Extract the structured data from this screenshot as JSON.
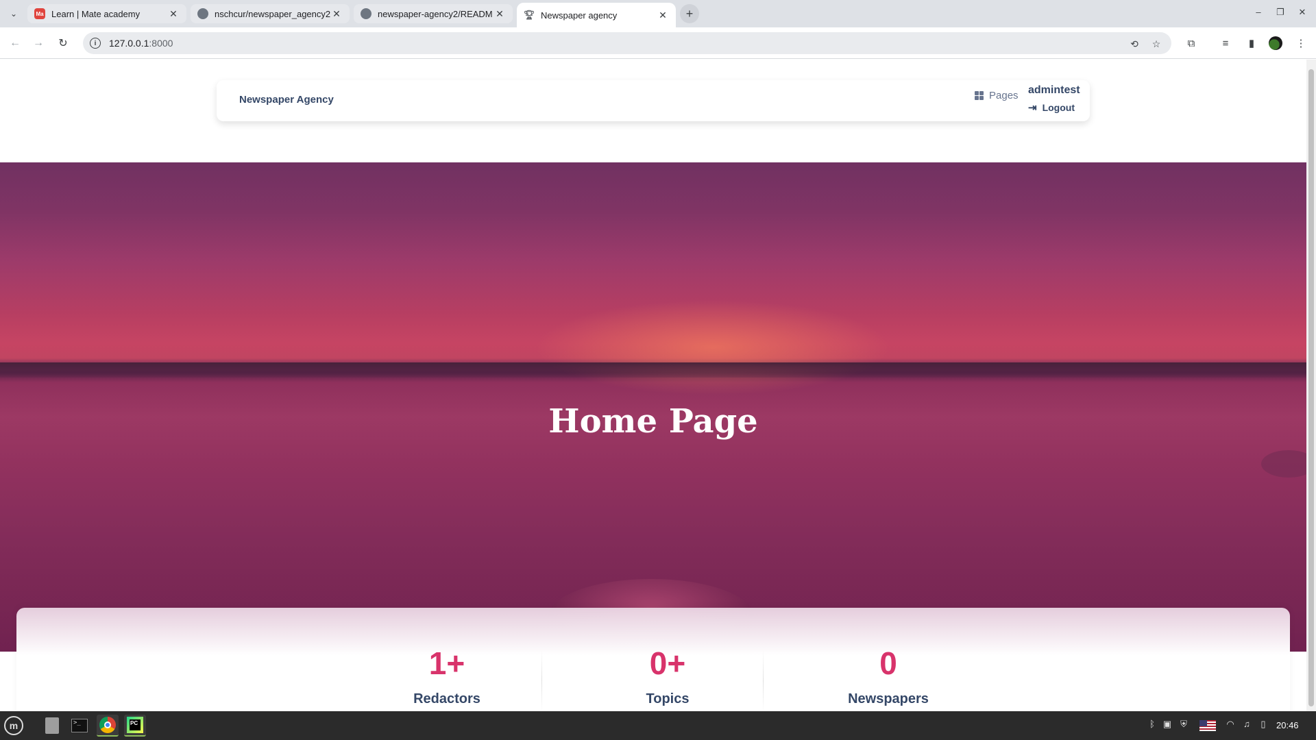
{
  "browser": {
    "tabs": [
      {
        "title": "Learn | Mate academy",
        "favicon": "mate-academy-icon",
        "active": false
      },
      {
        "title": "nschcur/newspaper_agency2",
        "favicon": "github-icon",
        "active": false
      },
      {
        "title": "newspaper-agency2/READM",
        "favicon": "github-icon",
        "active": false
      },
      {
        "title": "Newspaper agency",
        "favicon": "trophy-icon",
        "active": true
      }
    ],
    "url_host": "127.0.0.1",
    "url_port": ":8000"
  },
  "navbar": {
    "brand": "Newspaper Agency",
    "pages_label": "Pages",
    "username": "admintest",
    "logout_label": "Logout"
  },
  "hero": {
    "title": "Home Page"
  },
  "stats": [
    {
      "value": "1+",
      "label": "Redactors"
    },
    {
      "value": "0+",
      "label": "Topics"
    },
    {
      "value": "0",
      "label": "Newspapers"
    }
  ],
  "taskbar": {
    "clock": "20:46"
  },
  "colors": {
    "accent": "#d8336b",
    "text_dark": "#344767"
  }
}
